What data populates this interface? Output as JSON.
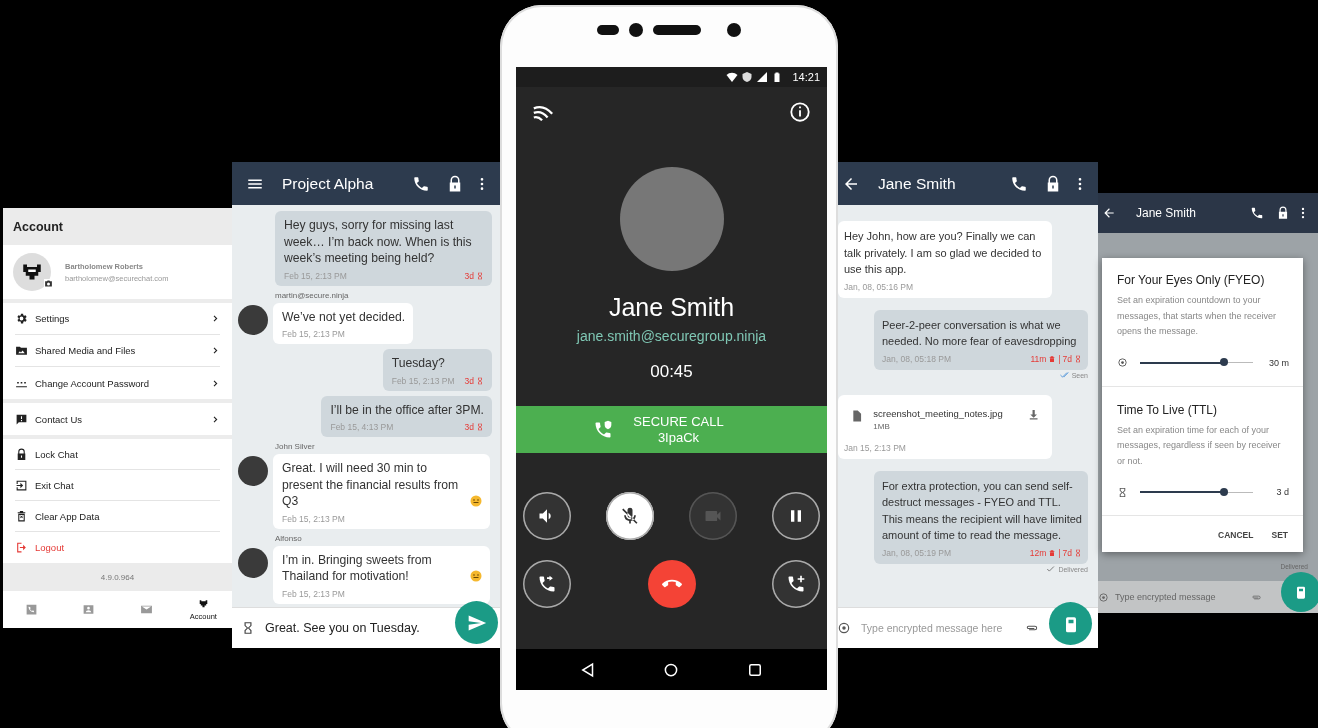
{
  "account": {
    "title": "Account",
    "name": "Bartholomew Roberts",
    "email": "bartholomew@securechat.com",
    "groups": [
      {
        "items": [
          {
            "kind": "settings",
            "label": "Settings",
            "chevron": true
          },
          {
            "kind": "media",
            "label": "Shared Media and Files",
            "chevron": true
          },
          {
            "kind": "password",
            "label": "Change Account Password",
            "chevron": true
          }
        ]
      },
      {
        "items": [
          {
            "kind": "contact",
            "label": "Contact Us",
            "chevron": true
          }
        ]
      },
      {
        "items": [
          {
            "kind": "lock",
            "label": "Lock Chat",
            "chevron": false
          },
          {
            "kind": "exit",
            "label": "Exit Chat",
            "chevron": false
          },
          {
            "kind": "clear",
            "label": "Clear App Data",
            "chevron": false
          },
          {
            "kind": "logout",
            "label": "Logout",
            "chevron": false
          }
        ]
      }
    ],
    "version": "4.9.0.964",
    "nav": [
      {
        "kind": "calls",
        "selected": false
      },
      {
        "kind": "contacts",
        "selected": false
      },
      {
        "kind": "messages",
        "selected": false
      },
      {
        "kind": "account",
        "label": "Account",
        "selected": true
      }
    ]
  },
  "group_chat": {
    "title": "Project Alpha",
    "messages": [
      {
        "kind": "outgoing",
        "text": "Hey guys, sorry for missing last week… I’m back now. When is this week’s meeting being held?",
        "time": "Feb 15, 2:13 PM",
        "ttl": "3d"
      },
      {
        "kind": "incoming",
        "sender": "martin@secure.ninja",
        "text": "We’ve not yet decided.",
        "time": "Feb 15, 2:13 PM"
      },
      {
        "kind": "outgoing",
        "text": "Tuesday?",
        "time": "Feb 15, 2:13 PM",
        "ttl": "3d"
      },
      {
        "kind": "outgoing",
        "text": "I’ll be in the office after 3PM.",
        "time": "Feb 15, 4:13 PM",
        "ttl": "3d"
      },
      {
        "kind": "incoming",
        "sender": "John Silver",
        "text": "Great. I will need 30 min to present the financial results from Q3",
        "time": "Feb 15, 2:13 PM",
        "emoji": true
      },
      {
        "kind": "incoming",
        "sender": "Alfonso",
        "text": "I’m in. Bringing sweets from Thailand for motivation!",
        "time": "Feb 15, 2:13 PM",
        "emoji": true
      }
    ],
    "composer": {
      "value": "Great. See you on Tuesday."
    }
  },
  "call": {
    "status_time": "14:21",
    "name": "Jane Smith",
    "email": "jane.smith@securegroup.ninja",
    "duration": "00:45",
    "banner": "SECURE CALL",
    "code": "3IpaCk",
    "controls": [
      {
        "kind": "speaker",
        "on": false,
        "disabled": false
      },
      {
        "kind": "mute",
        "on": true,
        "disabled": false
      },
      {
        "kind": "video",
        "on": false,
        "disabled": true
      },
      {
        "kind": "hold",
        "on": false,
        "disabled": false
      }
    ],
    "actions": [
      {
        "kind": "transfer"
      },
      {
        "kind": "end"
      },
      {
        "kind": "add"
      }
    ]
  },
  "direct_chat": {
    "title": "Jane Smith",
    "messages": [
      {
        "kind": "incoming",
        "text": "Hey John, how are you? Finally we can talk privately. I am so glad we decided to use this app.",
        "time": "Jan, 08, 05:16 PM"
      },
      {
        "kind": "outgoing",
        "text": "Peer-2-peer conversation is what we needed. No more fear of eavesdropping",
        "time": "Jan, 08, 05:18 PM",
        "fyeo": "11m",
        "separator": "|",
        "ttl": "7d",
        "receipt": "Seen",
        "read": true
      },
      {
        "kind": "file",
        "file_name": "screenshot_meeting_notes.jpg",
        "size": "1MB",
        "time": "Jan 15, 2:13 PM"
      },
      {
        "kind": "outgoing",
        "text": "For extra protection, you can send self-destruct messages - FYEO and TTL. This means the recipient will have limited amount of time to read the message.",
        "time": "Jan, 08, 05:19 PM",
        "fyeo": "12m",
        "separator": "|",
        "ttl": "7d",
        "receipt": "Delivered",
        "read": false
      }
    ],
    "composer": {
      "placeholder": "Type encrypted message here"
    }
  },
  "timer_dialog": {
    "title": "Jane Smith",
    "receipt": "Delivered",
    "sections": [
      {
        "kind": "fyeo",
        "title": "For Your Eyes Only (FYEO)",
        "text": "Set an expiration countdown to your messages, that starts when the receiver opens the message.",
        "level": 0.74,
        "reading": "30 m"
      },
      {
        "kind": "ttl",
        "title": "Time To Live (TTL)",
        "text": "Set an expiration time for each of your messages, regardless if seen by receiver or not.",
        "level": 0.74,
        "reading": "3 d"
      }
    ],
    "buttons": [
      "CANCEL",
      "SET"
    ],
    "composer": {
      "placeholder": "Type encrypted message"
    }
  }
}
